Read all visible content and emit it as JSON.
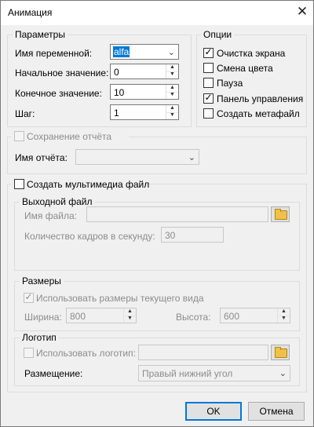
{
  "window": {
    "title": "Анимация",
    "close_glyph": "✕"
  },
  "params": {
    "legend": "Параметры",
    "var_name_label": "Имя переменной:",
    "var_name_value": "alfa",
    "start_label": "Начальное значение:",
    "start_value": "0",
    "end_label": "Конечное значение:",
    "end_value": "10",
    "step_label": "Шаг:",
    "step_value": "1"
  },
  "options": {
    "legend": "Опции",
    "items": [
      {
        "label": "Очистка экрана",
        "checked": true
      },
      {
        "label": "Смена цвета",
        "checked": false
      },
      {
        "label": "Пауза",
        "checked": false
      },
      {
        "label": "Панель управления",
        "checked": true
      },
      {
        "label": "Создать метафайл",
        "checked": false
      }
    ]
  },
  "report": {
    "save_label": "Сохранение отчёта",
    "name_label": "Имя отчёта:"
  },
  "multimedia": {
    "create_label": "Создать мультимедиа файл",
    "output_legend": "Выходной файл",
    "filename_label": "Имя файла:",
    "fps_label": "Количество кадров в секунду:",
    "fps_value": "30",
    "sizes_legend": "Размеры",
    "use_view_size_label": "Использовать размеры текущего вида",
    "width_label": "Ширина:",
    "width_value": "800",
    "height_label": "Высота:",
    "height_value": "600",
    "logo_legend": "Логотип",
    "use_logo_label": "Использовать логотип:",
    "placement_label": "Размещение:",
    "placement_value": "Правый нижний угол"
  },
  "buttons": {
    "ok": "OK",
    "cancel": "Отмена"
  },
  "glyphs": {
    "check": "✓",
    "up": "▲",
    "down": "▼",
    "combo": "⌄"
  }
}
